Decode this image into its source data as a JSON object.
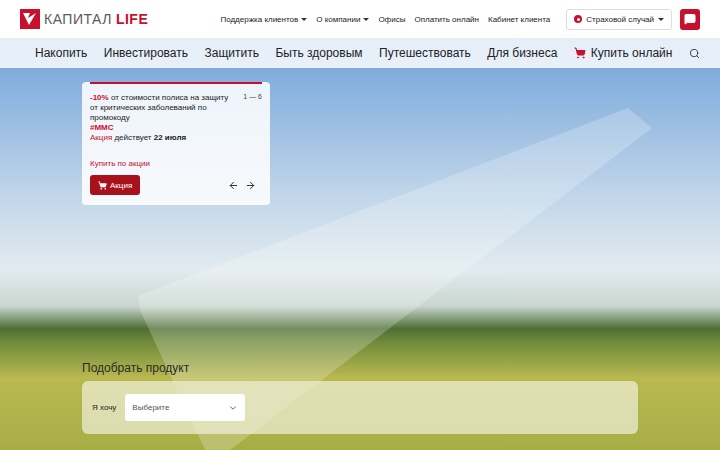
{
  "logo": {
    "name": "КАПИТАЛ",
    "accent": "LIFE"
  },
  "top_links": [
    {
      "label": "Поддержка клиентов",
      "dropdown": true
    },
    {
      "label": "О компании",
      "dropdown": true
    },
    {
      "label": "Офисы",
      "dropdown": false
    },
    {
      "label": "Оплатить онлайн",
      "dropdown": false
    },
    {
      "label": "Кабинет клиента",
      "dropdown": false
    }
  ],
  "claim_button": {
    "label": "Страховой случай",
    "dropdown": true
  },
  "nav": {
    "items": [
      "Накопить",
      "Инвестировать",
      "Защитить",
      "Быть здоровым",
      "Путешествовать",
      "Для бизнеса"
    ],
    "buy": "Купить онлайн"
  },
  "promo": {
    "discount": "-10%",
    "text": " от стоимости полиса на защиту от критических заболеваний по промокоду",
    "code": "#MMC",
    "tag": "Акция",
    "tag_text": " действует ",
    "date": "22 июля",
    "counter": "1 — 6",
    "link": "Купить по акции",
    "button": "Акция"
  },
  "picker": {
    "title": "Подобрать продукт",
    "label": "Я хочу",
    "placeholder": "Выберите"
  }
}
